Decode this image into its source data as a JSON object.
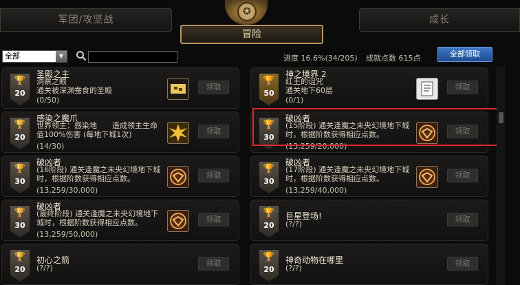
{
  "tabs": {
    "left": "军团/攻坚战",
    "center": "冒险",
    "right": "成长"
  },
  "filter": {
    "selected": "全部",
    "search_value": ""
  },
  "summary": {
    "progress": "进度 16.6%(34/205)",
    "points": "成就点数 615点",
    "claim_all": "全部领取"
  },
  "achievements": [
    {
      "title": "圣殿之主",
      "desc": "洞察之眼\n通关被深渊蚕食的圣殿",
      "progress": "(0/50)",
      "points": "20",
      "claim": "领取",
      "icon": "treasure-map-icon"
    },
    {
      "title": "神之境界 2",
      "desc": "红王的诅咒\n通关地下60层",
      "progress": "(0/1)",
      "points": "50",
      "claim": "领取",
      "icon": "scroll-icon"
    },
    {
      "title": "感染之魔爪",
      "desc": "世界领主：感染地　　造成领主生命值100%伤害 (每地下城1次)",
      "progress": "(14/30)",
      "points": "20",
      "claim": "领取",
      "icon": "burst-icon"
    },
    {
      "title": "破凶者",
      "desc": "(15阶段) 通关逢魔之未央幻境地下城时，根据阶数获得相应点数。",
      "progress": "(13,259/20,000)",
      "points": "30",
      "claim": "领取",
      "icon": "demon-mask-icon"
    },
    {
      "title": "破凶者",
      "desc": "(16阶段) 通关逢魔之未央幻境地下城时，根据阶数获得相应点数。",
      "progress": "(13,259/30,000)",
      "points": "30",
      "claim": "领取",
      "icon": "demon-mask-icon"
    },
    {
      "title": "破凶者",
      "desc": "(17阶段) 通关逢魔之未央幻境地下城时，根据阶数获得相应点数。",
      "progress": "(13,259/40,000)",
      "points": "30",
      "claim": "领取",
      "icon": "demon-mask-icon"
    },
    {
      "title": "破凶者",
      "desc": "(最终阶段) 通关逢魔之未央幻境地下城时，根据阶数获得相应点数。",
      "progress": "(13,259/50,000)",
      "points": "30",
      "claim": "领取",
      "icon": "demon-mask-icon"
    },
    {
      "title": "巨星登场!",
      "desc": "(?/?)",
      "progress": "",
      "points": "20",
      "claim": "领取",
      "icon": ""
    },
    {
      "title": "初心之箭",
      "desc": "(?/?)",
      "progress": "",
      "points": "20",
      "claim": "领取",
      "icon": ""
    },
    {
      "title": "神奇动物在哪里",
      "desc": "(?/?)",
      "progress": "",
      "points": "20",
      "claim": "领取",
      "icon": ""
    }
  ],
  "colors": {
    "highlight": "#e0282b",
    "claim_all_bg": "#2e63b0",
    "badge_gold": "#8a6a2c"
  }
}
